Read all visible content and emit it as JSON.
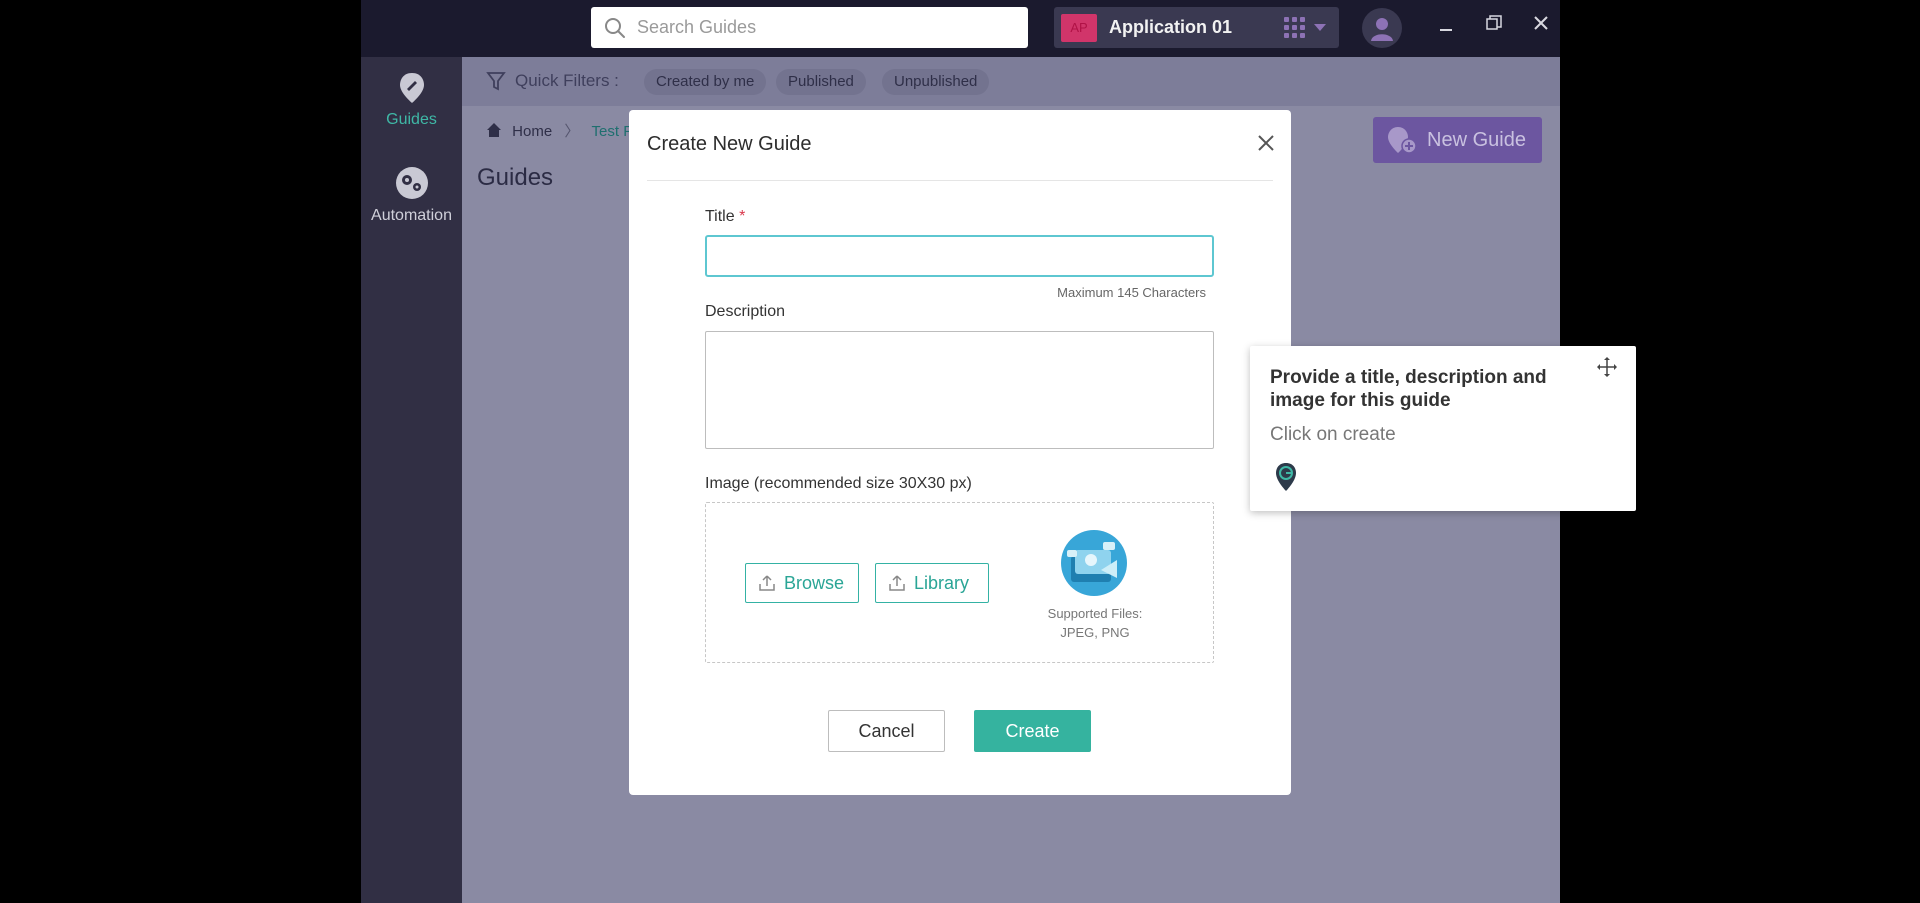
{
  "topbar": {
    "search_placeholder": "Search Guides",
    "app_badge": "AP",
    "app_name": "Application 01"
  },
  "sidebar": {
    "items": [
      {
        "label": "Guides",
        "icon": "guides-icon",
        "active": true
      },
      {
        "label": "Automation",
        "icon": "automation-icon",
        "active": false
      }
    ]
  },
  "filters": {
    "label": "Quick Filters :",
    "chips": [
      "Created by me",
      "Published",
      "Unpublished"
    ]
  },
  "breadcrumb": {
    "home": "Home",
    "current": "Test Fo"
  },
  "page": {
    "title": "Guides",
    "new_guide_label": "New Guide"
  },
  "modal": {
    "title": "Create New Guide",
    "title_label": "Title",
    "required_mark": "*",
    "title_value": "",
    "title_hint": "Maximum 145 Characters",
    "description_label": "Description",
    "description_value": "",
    "image_label": "Image (recommended size 30X30 px)",
    "browse_label": "Browse",
    "library_label": "Library",
    "supported_line1": "Supported Files:",
    "supported_line2": "JPEG, PNG",
    "cancel_label": "Cancel",
    "create_label": "Create"
  },
  "tooltip": {
    "title": "Provide a title, description and image for this guide",
    "subtitle": "Click on create"
  },
  "colors": {
    "accent": "#35b39f",
    "brand_purple": "#6c56a0",
    "topbar": "#1b1a2e",
    "sidebar": "#312f44",
    "active_nav": "#3fb8a6"
  }
}
